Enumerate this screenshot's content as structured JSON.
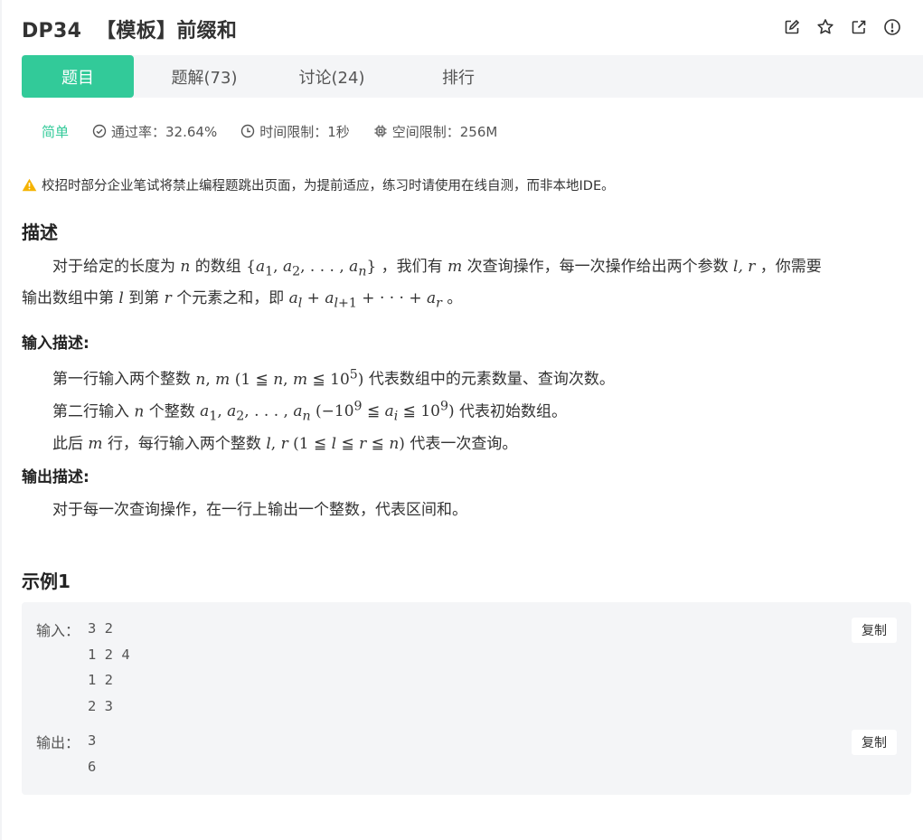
{
  "header": {
    "title": "DP34  【模板】前缀和",
    "icons": [
      "edit-icon",
      "star-icon",
      "external-link-icon",
      "info-icon"
    ]
  },
  "tabs": [
    {
      "label": "题目",
      "active": true
    },
    {
      "label": "题解(73)",
      "active": false
    },
    {
      "label": "讨论(24)",
      "active": false
    },
    {
      "label": "排行",
      "active": false
    }
  ],
  "meta": {
    "difficulty": "简单",
    "pass_rate": "通过率：32.64%",
    "time_limit": "时间限制：1秒",
    "memory_limit": "空间限制：256M"
  },
  "warning": "校招时部分企业笔试将禁止编程题跳出页面，为提前适应，练习时请使用在线自测，而非本地IDE。",
  "description": {
    "heading": "描述",
    "p1": "对于给定的长度为",
    "p2": "的数组",
    "p3": "，我们有",
    "p4": "次查询操作，每一次操作给出两个参数",
    "p5": "，你需要",
    "p6": "输出数组中第",
    "p7": "到第",
    "p8": "个元素之和，即",
    "p9": "。"
  },
  "input_desc": {
    "heading": "输入描述:",
    "l1a": "第一行输入两个整数",
    "l1b": "代表数组中的元素数量、查询次数。",
    "l2a": "第二行输入",
    "l2b": "个整数",
    "l2c": "代表初始数组。",
    "l3a": "此后",
    "l3b": "行，每行输入两个整数",
    "l3c": "代表一次查询。"
  },
  "output_desc": {
    "heading": "输出描述:",
    "text": "对于每一次查询操作，在一行上输出一个整数，代表区间和。"
  },
  "example": {
    "heading": "示例1",
    "input_label": "输入：",
    "input": "3 2\n1 2 4\n1 2\n2 3",
    "output_label": "输出：",
    "output": "3\n6",
    "copy_label": "复制"
  },
  "colors": {
    "accent": "#32ca99",
    "warning": "#f5b300",
    "panel": "#f4f5f7"
  }
}
